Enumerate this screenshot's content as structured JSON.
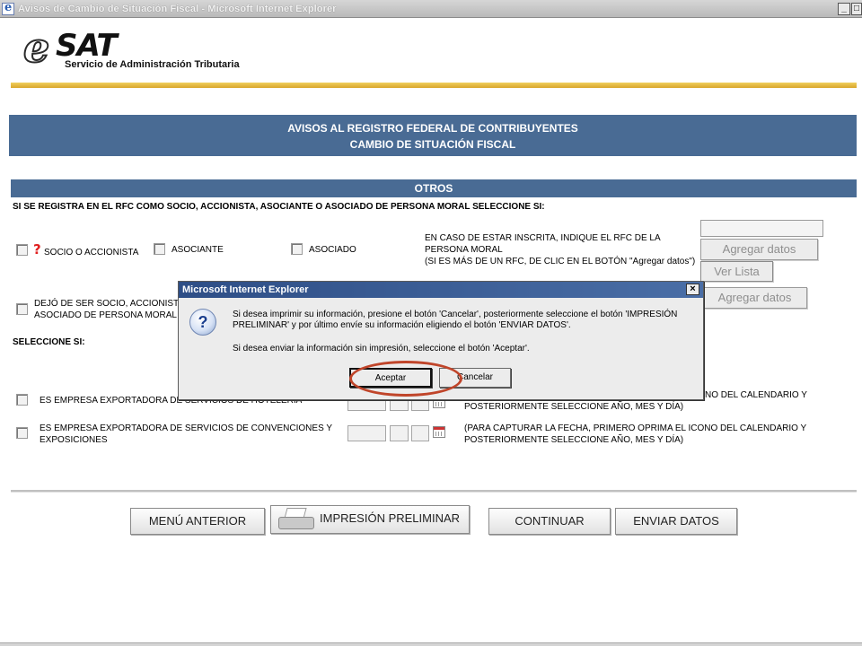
{
  "window": {
    "title": "Avisos de Cambio de Situación Fiscal - Microsoft Internet Explorer",
    "minimize_glyph": "_",
    "restore_glyph": "□"
  },
  "logo": {
    "mark": "e",
    "word": "SAT",
    "subtitle": "Servicio de Administración Tributaria"
  },
  "header": {
    "line1": "AVISOS AL REGISTRO FEDERAL DE CONTRIBUYENTES",
    "line2": "CAMBIO DE SITUACIÓN FISCAL"
  },
  "section": {
    "title": "OTROS",
    "instruction": "SI SE REGISTRA EN EL RFC COMO SOCIO, ACCIONISTA, ASOCIANTE O ASOCIADO DE PERSONA MORAL SELECCIONE SI:",
    "options": {
      "socio": "SOCIO O ACCIONISTA",
      "asociante": "ASOCIANTE",
      "asociado": "ASOCIADO"
    },
    "red_mark": "?",
    "rfc_note": [
      "EN CASO DE ESTAR INSCRITA, INDIQUE EL RFC DE LA",
      "PERSONA MORAL",
      "(SI ES MÁS DE UN RFC, DE CLIC EN EL BOTÓN \"Agregar datos\")"
    ],
    "agregar_label": "Agregar datos",
    "ver_lista_label": "Ver Lista",
    "dejo_label": [
      "DEJÓ DE SER SOCIO, ACCIONISTA",
      "ASOCIADO DE PERSONA MORAL"
    ],
    "agregar2_label": "Agregar datos",
    "seleccione": "SELECCIONE SI:",
    "row1": {
      "label": "ES EMPRESA EXPORTADORA DE SERVICIOS DE HOTELERÍA",
      "note": [
        "NO DEL CALENDARIO Y",
        "POSTERIORMENTE SELECCIONE AÑO, MES Y DÍA)"
      ]
    },
    "row2": {
      "label": [
        "ES EMPRESA EXPORTADORA DE SERVICIOS DE CONVENCIONES Y",
        "EXPOSICIONES"
      ],
      "note": [
        "(PARA CAPTURAR LA FECHA, PRIMERO OPRIMA EL ICONO DEL CALENDARIO Y",
        "POSTERIORMENTE SELECCIONE AÑO, MES Y DÍA)"
      ]
    }
  },
  "buttons": {
    "menu_anterior": "MENÚ ANTERIOR",
    "impresion": "IMPRESIÓN PRELIMINAR",
    "continuar": "CONTINUAR",
    "enviar": "ENVIAR DATOS"
  },
  "dialog": {
    "title": "Microsoft Internet Explorer",
    "close_glyph": "×",
    "icon": "?",
    "message1": "Si desea imprimir su información, presione el botón  'Cancelar', posteriormente seleccione el botón 'IMPRESIÓN PRELIMINAR' y por último envíe su información eligiendo el botón 'ENVIAR DATOS'.",
    "message2": "Si desea enviar la información sin impresión, seleccione el botón 'Aceptar'.",
    "ok_label": "Aceptar",
    "cancel_label": "Cancelar"
  },
  "colors": {
    "band_blue": "#496b94",
    "gold": "#d9a52a",
    "highlight": "#c0452a"
  }
}
